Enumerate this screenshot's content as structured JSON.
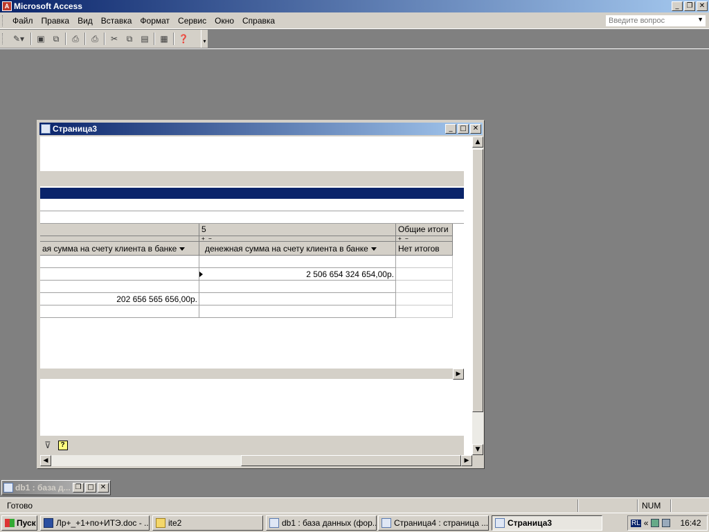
{
  "app": {
    "title": "Microsoft Access",
    "icon": "access-icon"
  },
  "menu": [
    "Файл",
    "Правка",
    "Вид",
    "Вставка",
    "Формат",
    "Сервис",
    "Окно",
    "Справка"
  ],
  "ask_placeholder": "Введите вопрос",
  "toolbar": [
    "design-view-icon",
    "save-icon",
    "web-page-preview-icon",
    "print-preview-icon",
    "print-icon",
    "cut-icon",
    "copy-icon",
    "paste-icon",
    "database-window-icon",
    "help-icon"
  ],
  "child": {
    "title": "Страница3",
    "pivot": {
      "column_field_value": "5",
      "grand_total_label": "Общие итоги",
      "measure_left": "ая сумма на счету клиента в банке",
      "measure_right": "денежная сумма на счету клиента в банке",
      "no_totals": "Нет итогов",
      "rows": [
        {
          "left": "",
          "right": ""
        },
        {
          "left": "",
          "right": "2 506 654 324 654,00р."
        },
        {
          "left": "",
          "right": ""
        },
        {
          "left": "202 656 565 656,00р.",
          "right": ""
        },
        {
          "left": "",
          "right": ""
        }
      ]
    }
  },
  "minimized": {
    "title": "db1 : база д..."
  },
  "status": {
    "ready": "Готово",
    "num": "NUM"
  },
  "taskbar": {
    "start": "Пуск",
    "tasks": [
      {
        "label": "Лр+_+1+по+ИТЭ.doc - ...",
        "icon": "word-doc-icon"
      },
      {
        "label": "ite2",
        "icon": "folder-icon"
      },
      {
        "label": "db1 : база данных (фор...",
        "icon": "access-db-icon"
      },
      {
        "label": "Страница4 : страница ...",
        "icon": "access-page-icon"
      },
      {
        "label": "Страница3",
        "icon": "access-page-icon"
      }
    ],
    "lang": "RL",
    "clock": "16:42"
  }
}
